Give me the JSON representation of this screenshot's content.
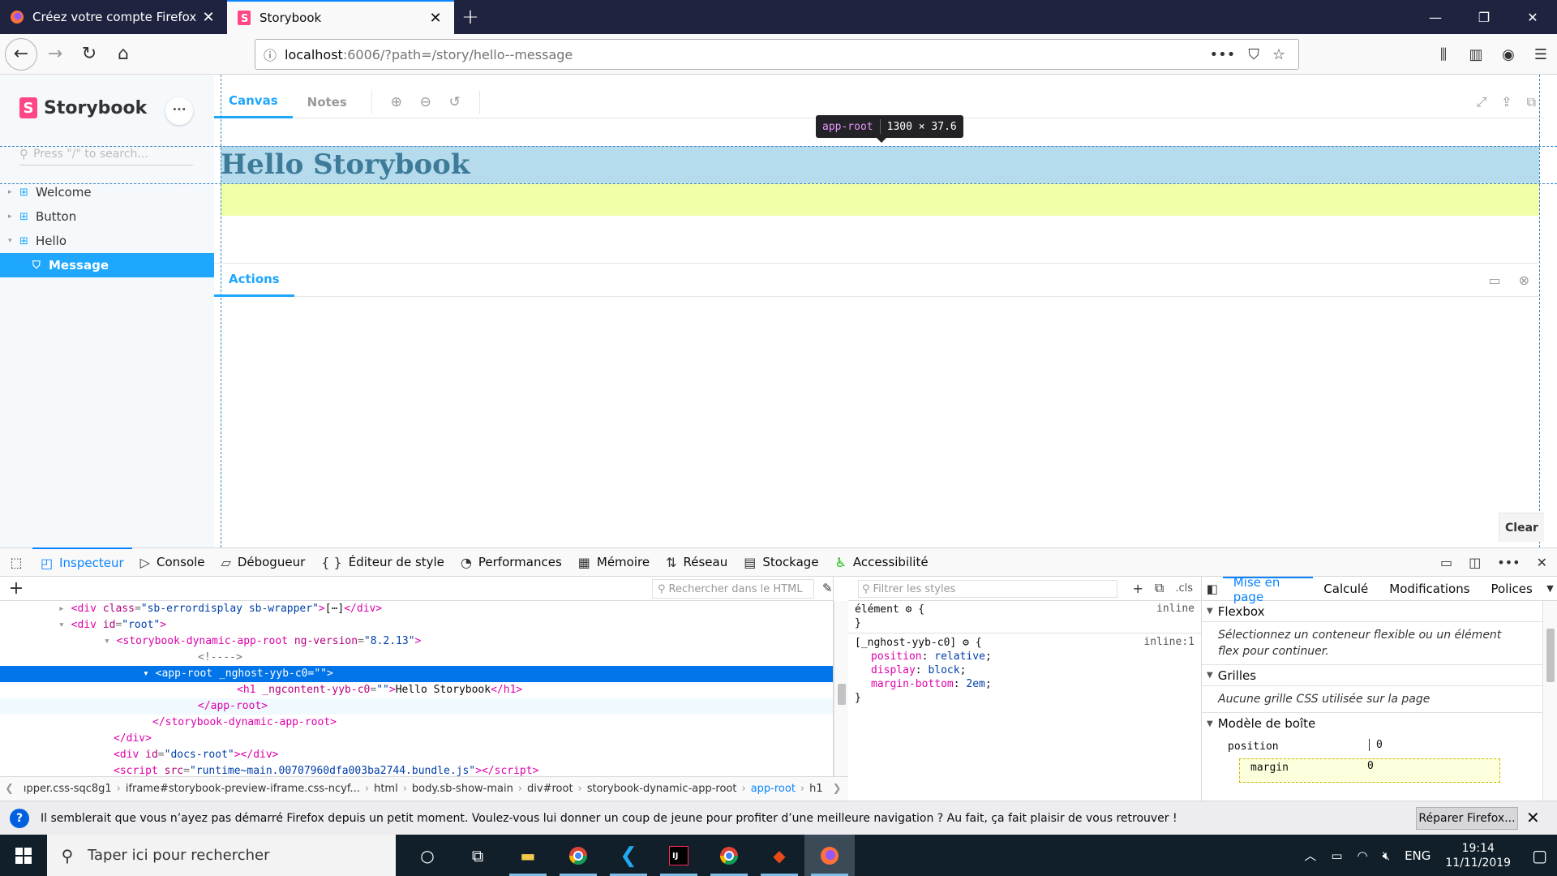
{
  "browser": {
    "tabs": [
      {
        "title": "Créez votre compte Firefox – V",
        "active": false
      },
      {
        "title": "Storybook",
        "active": true
      }
    ],
    "url_host": "localhost",
    "url_rest": ":6006/?path=/story/hello--message"
  },
  "storybook": {
    "brand": "Storybook",
    "search_placeholder": "Press \"/\" to search...",
    "tree": [
      {
        "label": "Welcome",
        "type": "component"
      },
      {
        "label": "Button",
        "type": "component"
      },
      {
        "label": "Hello",
        "type": "component"
      },
      {
        "label": "Message",
        "type": "story",
        "selected": true
      }
    ],
    "preview_tabs": [
      "Canvas",
      "Notes"
    ],
    "heading": "Hello Storybook",
    "tooltip": {
      "tag": "app-root",
      "size": "1300 × 37.6"
    },
    "addons_tab": "Actions",
    "clear_label": "Clear"
  },
  "devtools": {
    "tabs": [
      "Inspecteur",
      "Console",
      "Débogueur",
      "Éditeur de style",
      "Performances",
      "Mémoire",
      "Réseau",
      "Stockage",
      "Accessibilité"
    ],
    "markup_search_placeholder": "Rechercher dans le HTML",
    "markup_lines": [
      {
        "indent": 18,
        "twisty": "▸",
        "html": "<span class='tg'>&lt;div</span> <span class='an'>class</span>=<span class='av'>\"sb-errordisplay sb-wrapper\"</span><span class='tg'>&gt;</span><span class='tx'>[⋯]</span><span class='tg'>&lt;/div&gt;</span>"
      },
      {
        "indent": 18,
        "twisty": "▾",
        "html": "<span class='tg'>&lt;div</span> <span class='an'>id</span>=<span class='av'>\"root\"</span><span class='tg'>&gt;</span>"
      },
      {
        "indent": 32,
        "twisty": "▾",
        "html": "<span class='tg'>&lt;storybook-dynamic-app-root</span> <span class='an'>ng-version</span>=<span class='av'>\"8.2.13\"</span><span class='tg'>&gt;</span>"
      },
      {
        "indent": 58,
        "twisty": "",
        "html": "<span class='cm'>&lt;!----&gt;</span>"
      },
      {
        "indent": 44,
        "twisty": "▾",
        "sel": true,
        "html": "<span class='tg'>&lt;app-root</span> <span class='an'>_nghost-yyb-c0</span>=<span class='av'>\"\"</span><span class='tg'>&gt;</span>"
      },
      {
        "indent": 70,
        "twisty": "",
        "html": "<span class='tg'>&lt;h1</span> <span class='an'>_ngcontent-yyb-c0</span>=<span class='av'>\"\"</span><span class='tg'>&gt;</span><span class='tx'>Hello Storybook</span><span class='tg'>&lt;/h1&gt;</span>"
      },
      {
        "indent": 58,
        "twisty": "",
        "hov": true,
        "html": "<span class='tg'>&lt;/app-root&gt;</span>"
      },
      {
        "indent": 44,
        "twisty": "",
        "html": "<span class='tg'>&lt;/storybook-dynamic-app-root&gt;</span>"
      },
      {
        "indent": 32,
        "twisty": "",
        "html": "<span class='tg'>&lt;/div&gt;</span>"
      },
      {
        "indent": 32,
        "twisty": "",
        "html": "<span class='tg'>&lt;div</span> <span class='an'>id</span>=<span class='av'>\"docs-root\"</span><span class='tg'>&gt;&lt;/div&gt;</span>"
      },
      {
        "indent": 32,
        "twisty": "",
        "html": "<span class='tg'>&lt;script</span> <span class='an'>src</span>=<span class='av'>\"runtime~main.00707960dfa003ba2744.bundle.js\"</span><span class='tg'>&gt;&lt;/script&gt;</span>"
      }
    ],
    "breadcrumb": [
      "ıpper.css-sqc8g1",
      "iframe#storybook-preview-iframe.css-ncyf...",
      "html",
      "body.sb-show-main",
      "div#root",
      "storybook-dynamic-app-root",
      "app-root",
      "h1"
    ],
    "breadcrumb_selected": 6,
    "rules_filter_placeholder": "Filtrer les styles",
    "rules_cls": ".cls",
    "rules": [
      {
        "selector": "élément",
        "source": "inline",
        "decls": []
      },
      {
        "selector": "[_nghost-yyb-c0]",
        "source": "inline:1",
        "decls": [
          {
            "prop": "position",
            "val": "relative"
          },
          {
            "prop": "display",
            "val": "block"
          },
          {
            "prop": "margin-bottom",
            "val": "2em"
          }
        ]
      }
    ],
    "layout_tabs": [
      "Mise en page",
      "Calculé",
      "Modifications",
      "Polices"
    ],
    "flexbox_title": "Flexbox",
    "flexbox_msg": "Sélectionnez un conteneur flexible ou un élément flex pour continuer.",
    "grids_title": "Grilles",
    "grids_msg": "Aucune grille CSS utilisée sur la page",
    "boxmodel_title": "Modèle de boîte",
    "box_position_label": "position",
    "box_position_val": "0",
    "box_margin_label": "margin",
    "box_margin_val": "0"
  },
  "notification": {
    "text": "Il semblerait que vous n’ayez pas démarré Firefox depuis un petit moment. Voulez-vous lui donner un coup de jeune pour profiter d’une meilleure navigation ? Au fait, ça fait plaisir de vous retrouver !",
    "button": "Réparer Firefox..."
  },
  "taskbar": {
    "search_placeholder": "Taper ici pour rechercher",
    "lang": "ENG",
    "time": "19:14",
    "date": "11/11/2019"
  },
  "colors": {
    "accent": "#0a84ff",
    "storybook_blue": "#1ea7fd",
    "storybook_pink": "#ff4785",
    "highlight_content": "#b5dbed",
    "highlight_margin": "#f1ffa8"
  }
}
